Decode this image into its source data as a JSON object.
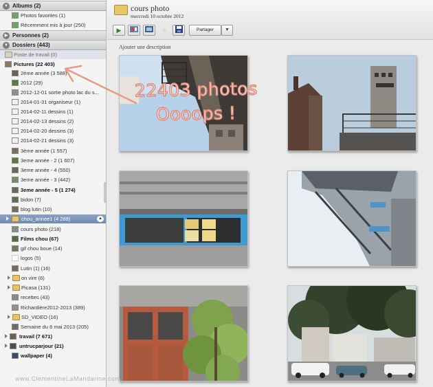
{
  "sidebar": {
    "albums": {
      "label": "Albums (2)",
      "items": [
        {
          "label": "Photos favorites (1)"
        },
        {
          "label": "Récemment mis à jour (250)"
        }
      ]
    },
    "personnes": {
      "label": "Personnes (2)"
    },
    "dossiers": {
      "label": "Dossiers (443)"
    },
    "folders": [
      {
        "label": "Poste de travail (0)"
      },
      {
        "label": "Pictures (22 403)"
      },
      {
        "label": "2ème année (3 588)"
      },
      {
        "label": "2012 (29)"
      },
      {
        "label": "2012-12-01 sortie photo lac du s..."
      },
      {
        "label": "2014-01-31 organiseur (1)"
      },
      {
        "label": "2014-02-11 dessins (1)"
      },
      {
        "label": "2014-02-13 dessins (2)"
      },
      {
        "label": "2014-02-20 dessins (3)"
      },
      {
        "label": "2014-02-21 dessins (3)"
      },
      {
        "label": "3ème année (1 557)"
      },
      {
        "label": "3eme année - 2 (1 607)"
      },
      {
        "label": "3eme année -  4 (550)"
      },
      {
        "label": "3eme année - 3 (442)"
      },
      {
        "label": "3eme année - 5 (1 274)"
      },
      {
        "label": "bidon (7)"
      },
      {
        "label": "blog lutin (10)"
      },
      {
        "label": "chou_annee1 (4 289)"
      },
      {
        "label": "cours photo (218)"
      },
      {
        "label": "Films chou (67)"
      },
      {
        "label": "gif chou boue (14)"
      },
      {
        "label": "logos (5)"
      },
      {
        "label": "Lutin (1) (16)"
      },
      {
        "label": "on vire (6)"
      },
      {
        "label": "Picasa (131)"
      },
      {
        "label": "recettes (43)"
      },
      {
        "label": "Richardière2012-2013 (389)"
      },
      {
        "label": "SD_VIDEO (16)"
      },
      {
        "label": "Semaine du 6 mai 2013 (205)"
      },
      {
        "label": "travail (7 671)"
      },
      {
        "label": "untrucparjour (21)"
      },
      {
        "label": "wallpaper (4)"
      }
    ]
  },
  "header": {
    "title": "cours photo",
    "date": "mercredi 10 octobre 2012",
    "share_label": "Partager",
    "description_placeholder": "Ajouter une description"
  },
  "annotation": {
    "line1": "22403 photos",
    "line2": "Oooops !"
  },
  "watermark": "www.ClementineLaMandarine.com"
}
